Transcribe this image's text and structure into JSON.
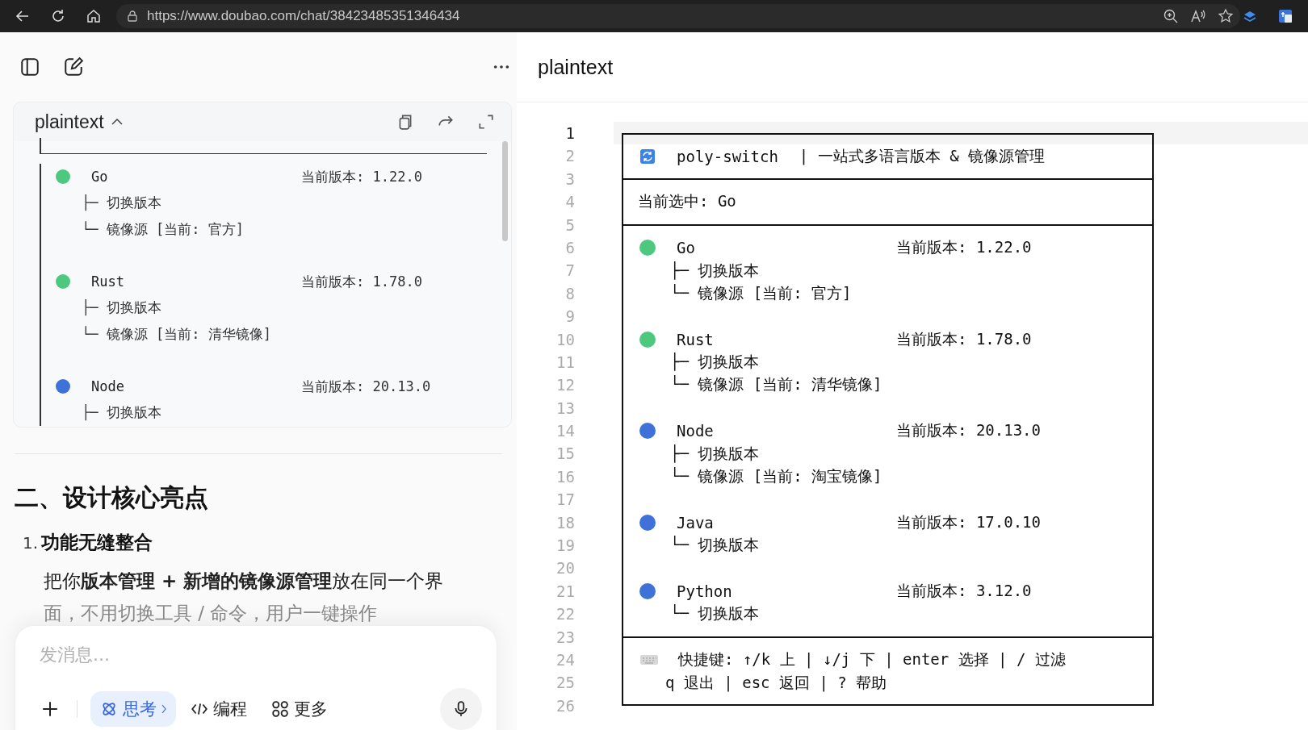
{
  "browser": {
    "url": "https://www.doubao.com/chat/38423485351346434"
  },
  "chat": {
    "code_block": {
      "title": "plaintext",
      "languages": [
        {
          "name": "Go",
          "version": "当前版本: 1.22.0",
          "color": "#4cc97f",
          "actions": [
            "├─ 切换版本",
            "└─ 镜像源 [当前: 官方]"
          ]
        },
        {
          "name": "Rust",
          "version": "当前版本: 1.78.0",
          "color": "#4cc97f",
          "actions": [
            "├─ 切换版本",
            "└─ 镜像源 [当前: 清华镜像]"
          ]
        },
        {
          "name": "Node",
          "version": "当前版本: 20.13.0",
          "color": "#3f72d9",
          "actions": [
            "├─ 切换版本"
          ]
        }
      ]
    },
    "heading": "二、设计核心亮点",
    "list_number": "1.",
    "list_title": "功能无缝整合",
    "paragraph": [
      "把你**版本管理 + 新增的镜像源管理**放在同一个界",
      "面，不用切换工具 / 命令，用户一键操作"
    ],
    "composer": {
      "placeholder": "发消息...",
      "modes": [
        {
          "label": "思考",
          "selected": true
        },
        {
          "label": "编程",
          "selected": false
        },
        {
          "label": "更多",
          "selected": false
        }
      ]
    }
  },
  "editor": {
    "title": "plaintext",
    "lines": [
      {
        "number": "1",
        "kind": "top",
        "current": true
      },
      {
        "number": "2",
        "kind": "header",
        "title": "poly-switch",
        "text": "| 一站式多语言版本 & 镜像源管理",
        "current": false
      },
      {
        "number": "3",
        "kind": "rule",
        "current": false
      },
      {
        "number": "4",
        "kind": "text",
        "text": "当前选中: Go",
        "current": false
      },
      {
        "number": "5",
        "kind": "rule",
        "current": false
      },
      {
        "number": "6",
        "kind": "item",
        "name": "Go",
        "version": "当前版本: 1.22.0",
        "color": "#4cc97f",
        "current": false
      },
      {
        "number": "7",
        "kind": "sub",
        "text": "├─ 切换版本",
        "current": false
      },
      {
        "number": "8",
        "kind": "sub",
        "text": "└─ 镜像源 [当前: 官方]",
        "current": false
      },
      {
        "number": "9",
        "kind": "blank",
        "current": false
      },
      {
        "number": "10",
        "kind": "item",
        "name": "Rust",
        "version": "当前版本: 1.78.0",
        "color": "#4cc97f",
        "current": false
      },
      {
        "number": "11",
        "kind": "sub",
        "text": "├─ 切换版本",
        "current": false
      },
      {
        "number": "12",
        "kind": "sub",
        "text": "└─ 镜像源 [当前: 清华镜像]",
        "current": false
      },
      {
        "number": "13",
        "kind": "blank",
        "current": false
      },
      {
        "number": "14",
        "kind": "item",
        "name": "Node",
        "version": "当前版本: 20.13.0",
        "color": "#3f72d9",
        "current": false
      },
      {
        "number": "15",
        "kind": "sub",
        "text": "├─ 切换版本",
        "current": false
      },
      {
        "number": "16",
        "kind": "sub",
        "text": "└─ 镜像源 [当前: 淘宝镜像]",
        "current": false
      },
      {
        "number": "17",
        "kind": "blank",
        "current": false
      },
      {
        "number": "18",
        "kind": "item",
        "name": "Java",
        "version": "当前版本: 17.0.10",
        "color": "#3f72d9",
        "current": false
      },
      {
        "number": "19",
        "kind": "sub",
        "text": "└─ 切换版本",
        "current": false
      },
      {
        "number": "20",
        "kind": "blank",
        "current": false
      },
      {
        "number": "21",
        "kind": "item",
        "name": "Python",
        "version": "当前版本: 3.12.0",
        "color": "#3f72d9",
        "current": false
      },
      {
        "number": "22",
        "kind": "sub",
        "text": "└─ 切换版本",
        "current": false
      },
      {
        "number": "23",
        "kind": "rule",
        "current": false
      },
      {
        "number": "24",
        "kind": "footer",
        "text": "快捷键: ↑/k 上 | ↓/j 下 | enter 选择 | / 过滤",
        "current": false
      },
      {
        "number": "25",
        "kind": "note",
        "text": "q 退出 | esc 返回 | ? 帮助",
        "current": false
      },
      {
        "number": "26",
        "kind": "bottom",
        "current": false
      }
    ]
  }
}
